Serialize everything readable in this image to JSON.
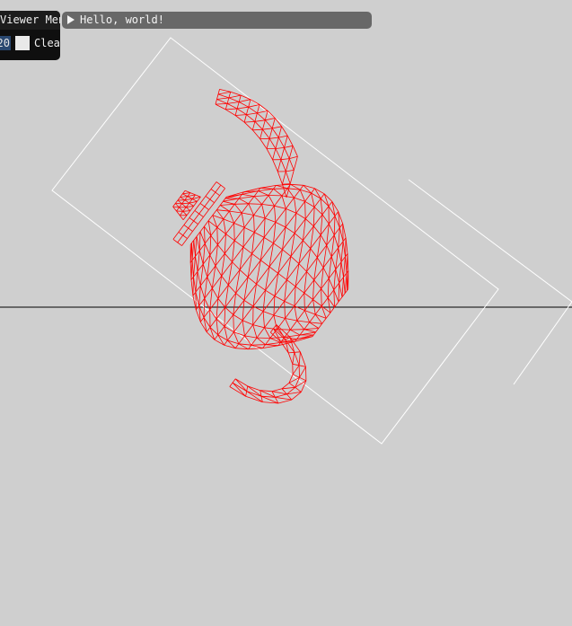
{
  "viewer_menu": {
    "title": "Viewer Menu",
    "field_value": "20",
    "clear_label": "Clear"
  },
  "hello_window": {
    "title": "Hello, world!",
    "collapsed": true
  },
  "colors": {
    "background": "#cfcfcf",
    "mesh": "#ff0000",
    "bounding_box": "#ffffff",
    "axis": "#000000"
  }
}
